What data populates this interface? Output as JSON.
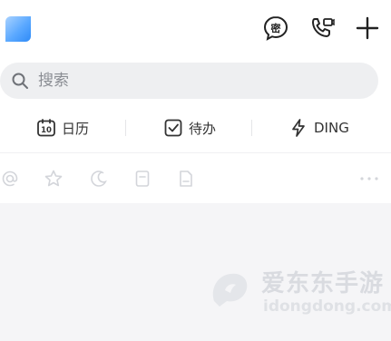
{
  "header": {
    "logo_icon": "app-logo",
    "secret_chat_label": "密",
    "icons": [
      "secret-chat-icon",
      "phone-call-icon",
      "add-icon"
    ]
  },
  "search": {
    "placeholder": "搜索",
    "icon": "search-icon"
  },
  "shortcuts": [
    {
      "label": "日历",
      "icon": "calendar-icon",
      "icon_text": "10"
    },
    {
      "label": "待办",
      "icon": "checkbox-icon"
    },
    {
      "label": "DING",
      "icon": "lightning-icon"
    }
  ],
  "filters": [
    "at-mention-icon",
    "star-icon",
    "clock-icon",
    "bookmark-icon",
    "file-icon",
    "more-icon"
  ],
  "watermark": {
    "title": "爱东东手游",
    "url": "idongdong.com"
  },
  "colors": {
    "accent": "#2f8bf7",
    "search_bg": "#eeeff1",
    "content_bg": "#f5f5f7",
    "muted_icon": "#d3d5da"
  }
}
